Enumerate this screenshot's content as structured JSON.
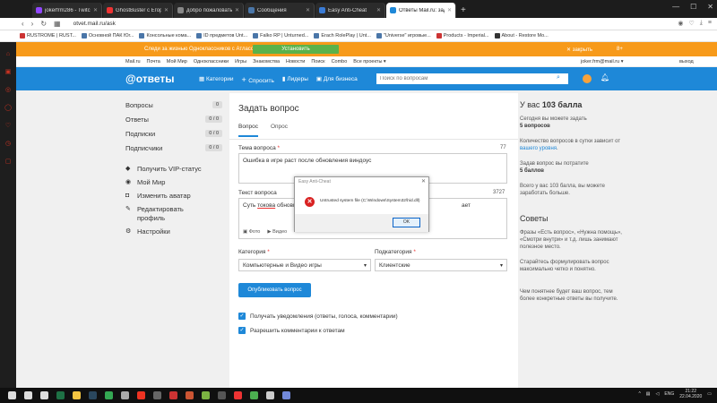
{
  "tabs": [
    {
      "title": "jokerfrm286 - Twitch",
      "color": "#9146ff"
    },
    {
      "title": "GhostBuster с Егором Кри",
      "color": "#e33"
    },
    {
      "title": "добро пожаловать | soul",
      "color": "#888"
    },
    {
      "title": "Сообщения",
      "color": "#4a76a8"
    },
    {
      "title": "Easy Anti-Cheat",
      "color": "#3a7bd5"
    },
    {
      "title": "Ответы Mail.ru: задать воп",
      "color": "#1e88d8",
      "active": true
    }
  ],
  "address": {
    "url": "otvet.mail.ru/ask"
  },
  "bookmarks": [
    {
      "label": "RUSTROME | RUST...",
      "color": "#c33"
    },
    {
      "label": "Основной ПАК Юг...",
      "color": "#4a76a8"
    },
    {
      "label": "Консольные кома...",
      "color": "#4a76a8"
    },
    {
      "label": "ID предметов Unt...",
      "color": "#4a76a8"
    },
    {
      "label": "Falko RP | Unturned...",
      "color": "#4a76a8"
    },
    {
      "label": "Erach RolePlay | Unt...",
      "color": "#4a76a8"
    },
    {
      "label": "\"Universe\" игровые...",
      "color": "#4a76a8"
    },
    {
      "label": "Products - Imperial...",
      "color": "#c33"
    },
    {
      "label": "About - Restore Mo...",
      "color": "#333"
    }
  ],
  "promo": {
    "text": "Следи за жизнью Одноклассников с Атласом",
    "button": "Установить",
    "close": "закрыть",
    "ok": "8+"
  },
  "mailbar": {
    "items": [
      "Mail.ru",
      "Почта",
      "Мой Мир",
      "Одноклассники",
      "Игры",
      "Знакомства",
      "Новости",
      "Поиск",
      "Combo",
      "Все проекты ▾"
    ],
    "user": "joker.frm@mail.ru ▾",
    "logout": "выход"
  },
  "header": {
    "logo": "@ответы",
    "nav": [
      "Категории",
      "Спросить",
      "Лидеры",
      "Для бизнеса"
    ],
    "search_placeholder": "Поиск по вопросам"
  },
  "leftnav": {
    "stats": [
      {
        "label": "Вопросы",
        "count": "0"
      },
      {
        "label": "Ответы",
        "count": "0 / 0"
      },
      {
        "label": "Подписки",
        "count": "0 / 0"
      },
      {
        "label": "Подписчики",
        "count": "0 / 0"
      }
    ],
    "actions": [
      "Получить VIP-статус",
      "Мой Мир",
      "Изменить аватар",
      "Редактировать профиль",
      "Настройки"
    ]
  },
  "form": {
    "title": "Задать вопрос",
    "tabs": [
      "Вопрос",
      "Опрос"
    ],
    "topic_label": "Тема вопроса",
    "topic_count": "77",
    "topic_value": "Ошибка в игре раст после обновления виндоус",
    "text_label": "Текст вопроса",
    "text_count": "3727",
    "text_value_start": "Суть",
    "text_value_u1": "токова",
    "text_value_mid": "обновил",
    "text_value_end": "ает",
    "attach_photo": "Фото",
    "attach_video": "Видео",
    "category_label": "Категория",
    "category_value": "Компьютерные и Видео игры",
    "subcategory_label": "Подкатегория",
    "subcategory_value": "Клиентские",
    "publish": "Опубликовать вопрос",
    "check1": "Получать уведомления (ответы, голоса, комментарии)",
    "check2": "Разрешить комментарии к ответам"
  },
  "rightcol": {
    "balance_prefix": "У вас ",
    "balance_value": "103 балла",
    "today_text": "Сегодня вы можете задать",
    "today_value": "5 вопросов",
    "level_text": "Количество вопросов в сутки зависит от ",
    "level_link": "вашего уровня",
    "cost_text": "Задав вопрос вы потратите",
    "cost_value": "5 баллов",
    "total_text": "Всего у вас 103 балла, вы можете заработать больше.",
    "tips_title": "Советы",
    "tip1": "Фразы «Есть вопрос», «Нужна помощь», «Смотри внутри» и т.д. лишь занимают полезное место.",
    "tip2": "Старайтесь формулировать вопрос максимально четко и понятно.",
    "tip3": "Чем понятнее будет ваш вопрос, тем более конкретные ответы вы получите."
  },
  "dialog": {
    "title": "Easy Anti-Cheat",
    "message": "Untrusted system file (C:\\Windows\\System32\\hid.dll)",
    "ok": "OK"
  },
  "taskbar": {
    "icons": [
      {
        "name": "windows-start-icon",
        "color": "#ddd"
      },
      {
        "name": "search-icon",
        "color": "#ddd"
      },
      {
        "name": "task-view-icon",
        "color": "#ddd"
      },
      {
        "name": "excel-icon",
        "color": "#1e7145"
      },
      {
        "name": "folder-icon",
        "color": "#f4c542"
      },
      {
        "name": "steam-icon",
        "color": "#2a475e"
      },
      {
        "name": "chrome-icon",
        "color": "#34a853"
      },
      {
        "name": "app-icon",
        "color": "#aaa"
      },
      {
        "name": "opera-icon",
        "color": "#e32"
      },
      {
        "name": "epic-icon",
        "color": "#666"
      },
      {
        "name": "game-icon",
        "color": "#c33"
      },
      {
        "name": "rust-icon",
        "color": "#c53"
      },
      {
        "name": "utorrent-icon",
        "color": "#7cb342"
      },
      {
        "name": "terminal-icon",
        "color": "#555"
      },
      {
        "name": "adobe-icon",
        "color": "#e33"
      },
      {
        "name": "shield-icon",
        "color": "#4caf50"
      },
      {
        "name": "app2-icon",
        "color": "#ccc"
      },
      {
        "name": "discord-icon",
        "color": "#7289da"
      }
    ],
    "lang": "ENG",
    "time": "21:22",
    "date": "22.04.2020"
  }
}
